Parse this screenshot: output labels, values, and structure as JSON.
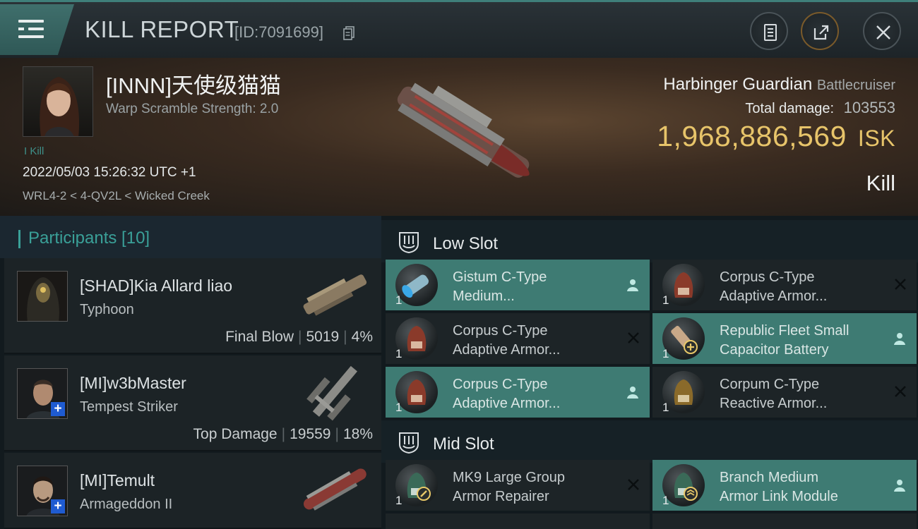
{
  "header": {
    "title": "KILL REPORT",
    "report_id": "[ID:7091699]",
    "icons": [
      "menu-icon",
      "copy-icon",
      "report-icon",
      "share-icon",
      "close-icon"
    ]
  },
  "victim": {
    "pilot": "[INNN]天使级猫猫",
    "scramble": "Warp Scramble Strength: 2.0",
    "kill_count": "I Kill",
    "timestamp": "2022/05/03 15:26:32 UTC +1",
    "location": "WRL4-2 < 4-QV2L < Wicked Creek",
    "ship": "Harbinger Guardian",
    "ship_class": "Battlecruiser",
    "total_damage_label": "Total damage:",
    "total_damage": "103553",
    "isk_value": "1,968,886,569",
    "isk_unit": "ISK",
    "outcome": "Kill"
  },
  "participants": {
    "label": "Participants [10]",
    "rows": [
      {
        "name": "[SHAD]Kia Allard liao",
        "ship": "Typhoon",
        "tag": "Final Blow",
        "damage": "5019",
        "pct": "4%"
      },
      {
        "name": "[MI]w3bMaster",
        "ship": "Tempest Striker",
        "tag": "Top Damage",
        "damage": "19559",
        "pct": "18%"
      },
      {
        "name": "[MI]Temult",
        "ship": "Armageddon II"
      }
    ]
  },
  "fitting": {
    "low_slot": {
      "label": "Low Slot",
      "modules": [
        {
          "name_l1": "Gistum C-Type",
          "name_l2": "Medium...",
          "qty": "1",
          "state": "dropped"
        },
        {
          "name_l1": "Corpus C-Type",
          "name_l2": "Adaptive Armor...",
          "qty": "1",
          "state": "destroyed"
        },
        {
          "name_l1": "Corpus C-Type",
          "name_l2": "Adaptive Armor...",
          "qty": "1",
          "state": "destroyed"
        },
        {
          "name_l1": "Republic Fleet Small",
          "name_l2": "Capacitor Battery",
          "qty": "1",
          "state": "dropped"
        },
        {
          "name_l1": "Corpus C-Type",
          "name_l2": "Adaptive Armor...",
          "qty": "1",
          "state": "dropped"
        },
        {
          "name_l1": "Corpum C-Type",
          "name_l2": "Reactive Armor...",
          "qty": "1",
          "state": "destroyed"
        }
      ]
    },
    "mid_slot": {
      "label": "Mid Slot",
      "modules": [
        {
          "name_l1": "MK9 Large Group",
          "name_l2": "Armor Repairer",
          "qty": "1",
          "state": "destroyed"
        },
        {
          "name_l1": "Branch Medium",
          "name_l2": "Armor Link Module",
          "qty": "1",
          "state": "dropped"
        }
      ]
    }
  }
}
